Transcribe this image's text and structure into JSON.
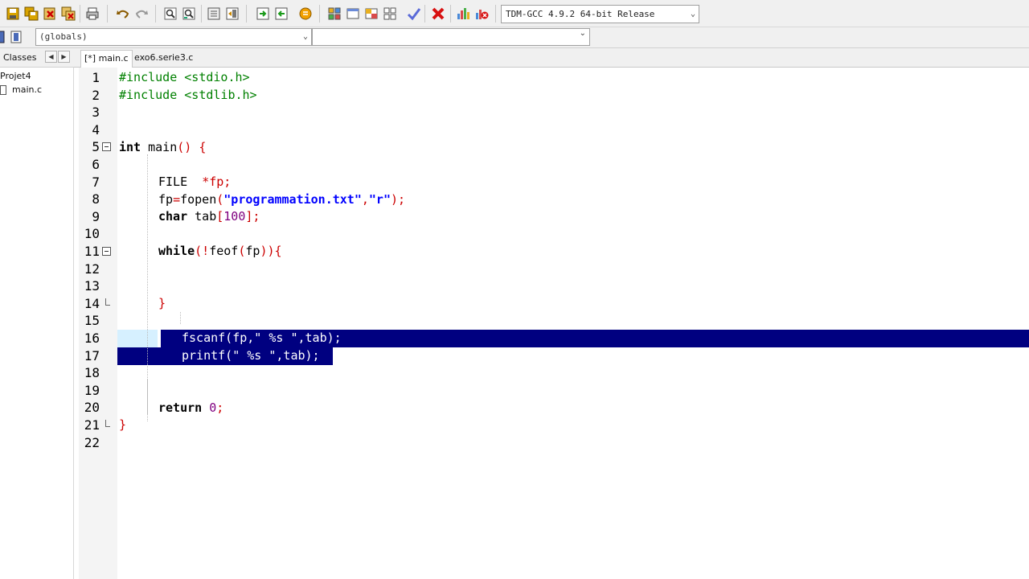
{
  "toolbar": {
    "compiler_select": "TDM-GCC 4.9.2 64-bit Release",
    "scope_select": "(globals)",
    "function_select": ""
  },
  "left_panel": {
    "tab_label": "Classes",
    "project_name": "Projet4",
    "project_file": "main.c"
  },
  "editor_tabs": [
    {
      "label": "[*] main.c",
      "active": true
    },
    {
      "label": "exo6.serie3.c",
      "active": false
    }
  ],
  "line_numbers": [
    "1",
    "2",
    "3",
    "4",
    "5",
    "6",
    "7",
    "8",
    "9",
    "10",
    "11",
    "12",
    "13",
    "14",
    "15",
    "16",
    "17",
    "18",
    "19",
    "20",
    "21",
    "22"
  ],
  "code": {
    "l1": "#include <stdio.h>",
    "l2": "#include <stdlib.h>",
    "l5_kw": "int",
    "l5_id": "main",
    "l5_sym": "() {",
    "l7_id": "FILE",
    "l7_sym": "*fp;",
    "l8_a": "fp",
    "l8_b": "=",
    "l8_c": "fopen",
    "l8_d": "(",
    "l8_e": "\"programmation.txt\"",
    "l8_f": ",",
    "l8_g": "\"r\"",
    "l8_h": ");",
    "l9_kw": "char",
    "l9_id": "tab",
    "l9_s1": "[",
    "l9_num": "100",
    "l9_s2": "];",
    "l11_kw": "while",
    "l11_s1": "(!",
    "l11_id1": "feof",
    "l11_s2": "(",
    "l11_id2": "fp",
    "l11_s3": ")){",
    "l14": "}",
    "l16": "fscanf(fp,\" %s \",tab);",
    "l17": "printf(\" %s \",tab);",
    "l20_kw": "return",
    "l20_num": "0",
    "l20_sym": ";",
    "l21": "}"
  },
  "colors": {
    "preprocessor": "#008000",
    "symbol": "#cc0000",
    "string": "#0000ff",
    "number": "#800080",
    "selection": "#000080"
  }
}
